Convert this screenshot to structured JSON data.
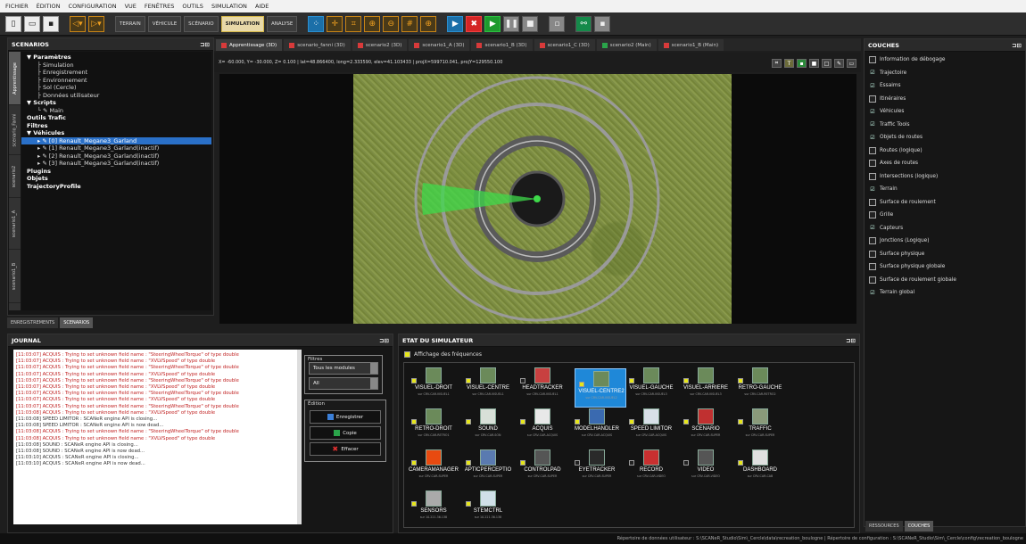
{
  "menu": [
    "FICHIER",
    "ÉDITION",
    "CONFIGURATION",
    "VUE",
    "FENÊTRES",
    "OUTILS",
    "SIMULATION",
    "AIDE"
  ],
  "toolbar": {
    "terrain": "TERRAIN",
    "vehicule": "VÉHICULE",
    "scenario": "SCÉNARIO",
    "simulation": "SIMULATION",
    "analyse": "ANALYSE"
  },
  "scenarios": {
    "title": "SCENARIOS",
    "vtabs": [
      "Apprentissage",
      "scenario_Fanni",
      "scenario2",
      "scenario1_A",
      "scenario1_B"
    ],
    "tree": [
      {
        "label": "Paramètres",
        "indent": 0,
        "style": "b",
        "pre": "▼"
      },
      {
        "label": "Simulation",
        "indent": 1
      },
      {
        "label": "Enregistrement",
        "indent": 1
      },
      {
        "label": "Environnement",
        "indent": 1
      },
      {
        "label": "Sol (Cercle)",
        "indent": 1
      },
      {
        "label": "Données utilisateur",
        "indent": 1
      },
      {
        "label": "Scripts",
        "indent": 0,
        "style": "b",
        "pre": "▼"
      },
      {
        "label": "Main",
        "indent": 1,
        "pre": "└ ✎"
      },
      {
        "label": "Outils Trafic",
        "indent": 0,
        "style": "b"
      },
      {
        "label": "Filtres",
        "indent": 0,
        "style": "b"
      },
      {
        "label": "Véhicules",
        "indent": 0,
        "style": "b",
        "pre": "▼"
      },
      {
        "label": "[0] Renault_Megane3_Garland",
        "indent": 1,
        "style": "hl",
        "pre": "▸ ✎"
      },
      {
        "label": "[1] Renault_Megane3_Garland(inactif)",
        "indent": 1,
        "pre": "▸ ✎"
      },
      {
        "label": "[2] Renault_Megane3_Garland(inactif)",
        "indent": 1,
        "pre": "▸ ✎"
      },
      {
        "label": "[3] Renault_Megane3_Garland(inactif)",
        "indent": 1,
        "pre": "▸ ✎"
      },
      {
        "label": "Plugins",
        "indent": 0,
        "style": "b"
      },
      {
        "label": "Objets",
        "indent": 0,
        "style": "b"
      },
      {
        "label": "TrajectoryProfile",
        "indent": 0,
        "style": "b"
      }
    ],
    "bottom_tabs": [
      "ENREGISTREMENTS",
      "SCENARIOS"
    ]
  },
  "doc_tabs": [
    {
      "label": "Apprentissage (3D)",
      "icon": "r",
      "active": true
    },
    {
      "label": "scenario_fanni (3D)",
      "icon": "r"
    },
    {
      "label": "scenario2 (3D)",
      "icon": "r"
    },
    {
      "label": "scenario1_A (3D)",
      "icon": "r"
    },
    {
      "label": "scenario1_B (3D)",
      "icon": "r"
    },
    {
      "label": "scenario1_C (3D)",
      "icon": "r"
    },
    {
      "label": "scenario2 (Main)",
      "icon": "g"
    },
    {
      "label": "scenario1_B (Main)",
      "icon": "r"
    }
  ],
  "coords_text": "X= -60.000, Y= -30.000, Z= 0.100 | lat=48.866400, long=2.333590, elev=41.103433 | projX=599710.041, projY=129550.100",
  "journal": {
    "title": "JOURNAL",
    "lines": [
      "[11:03:07] ACQUIS : Trying to set unknown field name : \"SteeringWheelTorque\" of type double",
      "[11:03:07] ACQUIS : Trying to set unknown field name : \"XVLVSpeed\" of type double",
      "[11:03:07] ACQUIS : Trying to set unknown field name : \"SteeringWheelTorque\" of type double",
      "[11:03:07] ACQUIS : Trying to set unknown field name : \"XVLVSpeed\" of type double",
      "[11:03:07] ACQUIS : Trying to set unknown field name : \"SteeringWheelTorque\" of type double",
      "[11:03:07] ACQUIS : Trying to set unknown field name : \"XVLVSpeed\" of type double",
      "[11:03:07] ACQUIS : Trying to set unknown field name : \"SteeringWheelTorque\" of type double",
      "[11:03:07] ACQUIS : Trying to set unknown field name : \"XVLVSpeed\" of type double",
      "[11:03:07] ACQUIS : Trying to set unknown field name : \"SteeringWheelTorque\" of type double",
      "[11:03:08] ACQUIS : Trying to set unknown field name : \"XVLVSpeed\" of type double",
      "[11:03:08] SPEED LIMITOR : SCANeR engine API is closing...",
      "[11:03:08] SPEED LIMITOR : SCANeR engine API is now dead...",
      "[11:03:08] ACQUIS : Trying to set unknown field name : \"SteeringWheelTorque\" of type double",
      "[11:03:08] ACQUIS : Trying to set unknown field name : \"XVLVSpeed\" of type double",
      "[11:03:08] SOUND : SCANeR engine API is closing...",
      "[11:03:08] SOUND : SCANeR engine API is now dead...",
      "[11:03:10] ACQUIS : SCANeR engine API is closing...",
      "[11:03:10] ACQUIS : SCANeR engine API is now dead..."
    ],
    "filters_title": "Filtres",
    "filter_module": "Tous les modules",
    "filter_level": "All",
    "edition_title": "Édition",
    "save": "Enregistrer",
    "copy": "Copie",
    "clear": "Effacer"
  },
  "simulator": {
    "title": "ETAT DU SIMULATEUR",
    "freq_label": "Affichage des fréquences",
    "modules": [
      {
        "name": "VISUEL-DROIT",
        "sub": "sur CRV-CAR-VISUEL1",
        "on": true
      },
      {
        "name": "VISUEL-CENTRE",
        "sub": "sur CRV-CAR-VISUEL1",
        "on": true
      },
      {
        "name": "HEADTRACKER",
        "sub": "sur CRV-CAR-VISUEL1",
        "on": false
      },
      {
        "name": "VISUEL-CENTRE2",
        "sub": "sur CRV-CAR-VISUEL2",
        "on": true,
        "sel": true
      },
      {
        "name": "VISUEL-GAUCHE",
        "sub": "sur CRV-CAR-VISUEL3",
        "on": true
      },
      {
        "name": "VISUEL-ARRIERE",
        "sub": "sur CRV-CAR-VISUEL3",
        "on": true
      },
      {
        "name": "RETRO-GAUCHE",
        "sub": "sur CRV-CAR-RETRO2",
        "on": true
      },
      {
        "name": "RETRO-DROIT",
        "sub": "sur CRV-CAR-RETRO1",
        "on": true
      },
      {
        "name": "SOUND",
        "sub": "sur CRV-CAR-SON",
        "on": true
      },
      {
        "name": "ACQUIS",
        "sub": "sur CRV-CAR-ACQUIS",
        "on": true
      },
      {
        "name": "MODELHANDLER",
        "sub": "sur CRV-CAR-ACQUIS",
        "on": true
      },
      {
        "name": "SPEED LIMITOR",
        "sub": "sur CRV-CAR-ACQUIS",
        "on": true
      },
      {
        "name": "SCENARIO",
        "sub": "sur CRV-CAR-SUPER",
        "on": true
      },
      {
        "name": "TRAFFIC",
        "sub": "sur CRV-CAR-SUPER",
        "on": true
      },
      {
        "name": "CAMERAMANAGER",
        "sub": "sur CRV-CAR-SUPER",
        "on": true
      },
      {
        "name": "APTICPERCEPTIO",
        "sub": "sur CRV-CAR-SUPER",
        "on": true
      },
      {
        "name": "CONTROLPAD",
        "sub": "sur CRV-CAR-SUPER",
        "on": true
      },
      {
        "name": "EYETRACKER",
        "sub": "sur CRV-CAR-SUPER",
        "on": false
      },
      {
        "name": "RECORD",
        "sub": "sur CRV-CAR-VIDEO",
        "on": false
      },
      {
        "name": "VIDEO",
        "sub": "sur CRV-CAR-VIDEO",
        "on": false
      },
      {
        "name": "DASHBOARD",
        "sub": "sur CRV-CAR-CAB",
        "on": true
      },
      {
        "name": "SENSORS",
        "sub": "sur 10.221.36.138",
        "on": true
      },
      {
        "name": "STEMCTRL",
        "sub": "sur 10.221.36.138",
        "on": true
      }
    ]
  },
  "couches": {
    "title": "COUCHES",
    "layers": [
      {
        "label": "Information de débogage",
        "checked": false
      },
      {
        "label": "Trajectoire",
        "checked": true
      },
      {
        "label": "Essaims",
        "checked": true
      },
      {
        "label": "Itinéraires",
        "checked": false
      },
      {
        "label": "Véhicules",
        "checked": true
      },
      {
        "label": "Traffic Tools",
        "checked": true
      },
      {
        "label": "Objets de routes",
        "checked": true
      },
      {
        "label": "Routes (logique)",
        "checked": false
      },
      {
        "label": "Axes de routes",
        "checked": false
      },
      {
        "label": "Intersections (logique)",
        "checked": false
      },
      {
        "label": "Terrain",
        "checked": true
      },
      {
        "label": "Surface de roulement",
        "checked": false
      },
      {
        "label": "Grille",
        "checked": false
      },
      {
        "label": "Capteurs",
        "checked": true
      },
      {
        "label": "Jonctions (Logique)",
        "checked": false
      },
      {
        "label": "Surface physique",
        "checked": false
      },
      {
        "label": "Surface physique globale",
        "checked": false
      },
      {
        "label": "Surface de roulement globale",
        "checked": false
      },
      {
        "label": "Terrain global",
        "checked": true
      }
    ],
    "tabs": [
      "RESSOURCES",
      "COUCHES"
    ]
  },
  "status": "Répertoire de données utilisateur : S:\\SCANeR_Studio\\Sim\\_Cercle\\data\\recreation_boulogne | Répertoire de configuration : S:\\SCANeR_Studio\\Sim\\_Cercle\\config\\recreation_boulogne"
}
